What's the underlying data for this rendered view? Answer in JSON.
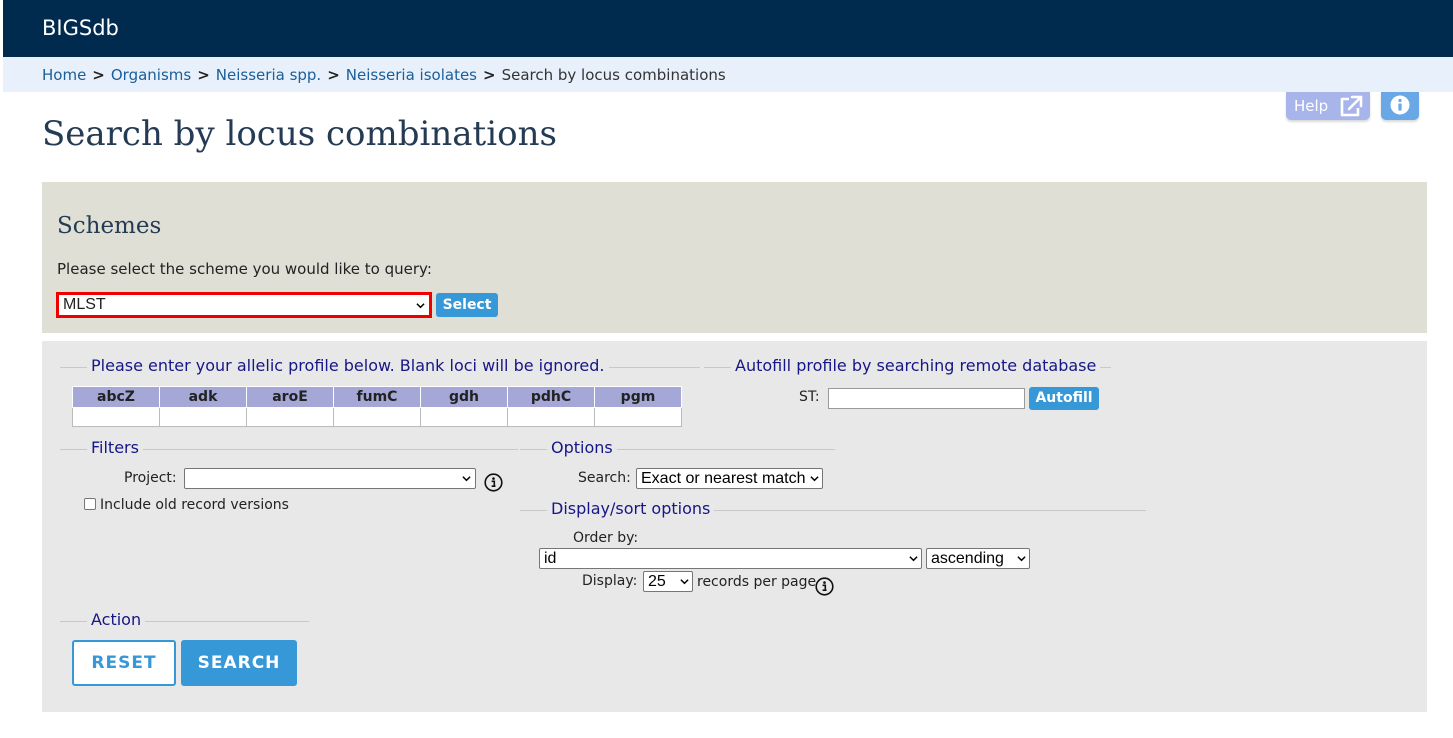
{
  "app": {
    "brand": "BIGSdb"
  },
  "breadcrumb": {
    "items": [
      "Home",
      "Organisms",
      "Neisseria spp.",
      "Neisseria isolates"
    ],
    "current": "Search by locus combinations",
    "separator": ">"
  },
  "help": {
    "label": "Help",
    "icon": "external-link-icon",
    "info_icon": "info-icon"
  },
  "page": {
    "title": "Search by locus combinations"
  },
  "schemes": {
    "heading": "Schemes",
    "prompt": "Please select the scheme you would like to query:",
    "selected": "MLST",
    "select_button": "Select"
  },
  "profile": {
    "legend": "Please enter your allelic profile below. Blank loci will be ignored.",
    "loci": [
      "abcZ",
      "adk",
      "aroE",
      "fumC",
      "gdh",
      "pdhC",
      "pgm"
    ]
  },
  "autofill": {
    "legend": "Autofill profile by searching remote database",
    "st_label": "ST:",
    "st_value": "",
    "button": "Autofill"
  },
  "filters": {
    "legend": "Filters",
    "project_label": "Project:",
    "project_value": "",
    "old_versions_label": "Include old record versions",
    "old_versions_checked": false
  },
  "options": {
    "legend": "Options",
    "search_label": "Search:",
    "search_value": "Exact or nearest match"
  },
  "display": {
    "legend": "Display/sort options",
    "order_label": "Order by:",
    "order_value": "id",
    "direction_value": "ascending",
    "display_label": "Display:",
    "display_value": "25",
    "per_page_label": "records per page"
  },
  "action": {
    "legend": "Action",
    "reset": "RESET",
    "search": "SEARCH"
  },
  "colors": {
    "topbar": "#002b4e",
    "breadcrumb_bg": "#e8f1fb",
    "accent": "#3798d8",
    "schemes_bg": "#e0dfd5",
    "panel_bg": "#e8e8e8",
    "legend": "#161687",
    "highlight": "#ee0000"
  }
}
